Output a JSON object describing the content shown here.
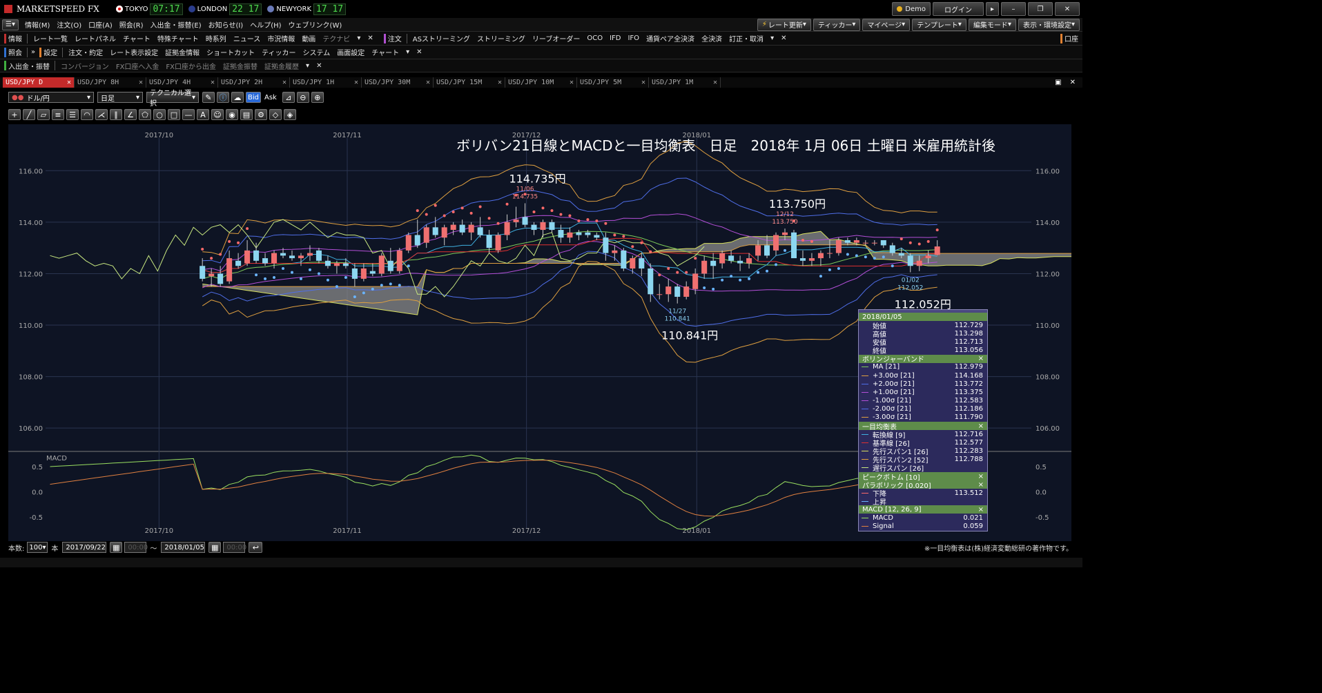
{
  "titlebar": {
    "logo": "MARKETSPEED FX",
    "clocks": [
      {
        "city": "TOKYO",
        "time": "07:17"
      },
      {
        "city": "LONDON",
        "time": "22 17"
      },
      {
        "city": "NEWYORK",
        "time": "17 17"
      }
    ],
    "demo": "Demo",
    "login": "ログイン"
  },
  "menubar": {
    "items": [
      "情報(M)",
      "注文(O)",
      "口座(A)",
      "照会(R)",
      "入出金・振替(E)",
      "お知らせ(I)",
      "ヘルプ(H)",
      "ウェブリンク(W)"
    ],
    "right_buttons": [
      "レート更新",
      "ティッカー",
      "マイページ",
      "テンプレート",
      "編集モード",
      "表示・環境設定"
    ]
  },
  "toolbar1": {
    "left_label": "情報",
    "items": [
      "レート一覧",
      "レートパネル",
      "チャート",
      "特殊チャート",
      "時系列",
      "ニュース",
      "市況情報",
      "動画",
      "テクナビ"
    ],
    "order_label": "注文",
    "order_items": [
      "ASストリーミング",
      "ストリーミング",
      "リーブオーダー",
      "OCO",
      "IFD",
      "IFO",
      "通貨ペア全決済",
      "全決済",
      "訂正・取消"
    ],
    "right_label": "口座"
  },
  "toolbar2": {
    "left_label": "照会",
    "settings_label": "設定",
    "items": [
      "注文・約定",
      "レート表示設定",
      "証拠金情報",
      "ショートカット",
      "ティッカー",
      "システム",
      "画面設定",
      "チャート"
    ]
  },
  "toolbar3": {
    "left_label": "入出金・振替",
    "items": [
      "コンバージョン",
      "FX口座へ入金",
      "FX口座から出金",
      "証拠金振替",
      "証拠金履歴"
    ]
  },
  "tabs": [
    "USD/JPY D",
    "USD/JPY 8H",
    "USD/JPY 4H",
    "USD/JPY 2H",
    "USD/JPY 1H",
    "USD/JPY 30M",
    "USD/JPY 15M",
    "USD/JPY 10M",
    "USD/JPY 5M",
    "USD/JPY 1M"
  ],
  "controls": {
    "pair": "ドル/円",
    "timeframe": "日足",
    "technical": "テクニカル選択",
    "bid": "Bid",
    "ask": "Ask"
  },
  "footer": {
    "count_label": "本数:",
    "count_value": "100",
    "count_unit": "本",
    "start_date": "2017/09/22",
    "time_placeholder": "00:00",
    "tilde": "〜",
    "end_date": "2018/01/05",
    "copyright": "※一目均衡表は(株)経済変動総研の著作物です。"
  },
  "chart_data": {
    "type": "candlestick",
    "title": "ボリバン21日線とMACDと一目均衡表　日足　2018年 1月 06日 土曜日 米雇用統計後",
    "y_ticks": [
      "116.00",
      "114.00",
      "112.00",
      "110.00",
      "108.00",
      "106.00"
    ],
    "x_ticks": [
      "2017/10",
      "2017/11",
      "2017/12",
      "2018/01"
    ],
    "ylim": [
      105.2,
      117.0
    ],
    "macd_label": "MACD",
    "macd_ticks": [
      "0.5",
      "0.0",
      "-0.5"
    ],
    "macd_ylim": [
      -0.72,
      0.72
    ],
    "annotations": [
      {
        "text": "114.735円",
        "date": "11/06",
        "value": "114.735"
      },
      {
        "text": "113.750円",
        "date": "12/12",
        "value": "113.750"
      },
      {
        "text": "110.841円",
        "date": "11/27",
        "value": "110.841"
      },
      {
        "text": "112.052円",
        "date": "01/02",
        "value": "112.052"
      }
    ],
    "candles": [
      [
        112.3,
        112.6,
        111.7,
        111.8
      ],
      [
        111.9,
        112.2,
        111.5,
        112.0
      ],
      [
        112.0,
        112.3,
        111.5,
        111.6
      ],
      [
        111.7,
        112.9,
        111.6,
        112.6
      ],
      [
        112.5,
        112.8,
        112.2,
        112.3
      ],
      [
        112.4,
        113.3,
        112.3,
        112.9
      ],
      [
        112.9,
        113.2,
        112.4,
        112.5
      ],
      [
        112.6,
        112.8,
        112.3,
        112.4
      ],
      [
        112.4,
        112.9,
        112.2,
        112.8
      ],
      [
        112.8,
        113.0,
        112.6,
        112.7
      ],
      [
        112.7,
        112.9,
        112.5,
        112.6
      ],
      [
        112.6,
        112.8,
        112.3,
        112.7
      ],
      [
        112.7,
        113.1,
        112.5,
        112.8
      ],
      [
        112.9,
        113.0,
        112.4,
        112.5
      ],
      [
        112.5,
        112.7,
        112.2,
        112.3
      ],
      [
        112.3,
        112.5,
        112.0,
        112.4
      ],
      [
        112.4,
        112.6,
        112.2,
        112.3
      ],
      [
        112.2,
        112.4,
        111.5,
        111.8
      ],
      [
        111.8,
        112.4,
        111.7,
        112.2
      ],
      [
        112.1,
        112.4,
        111.9,
        112.0
      ],
      [
        112.0,
        112.8,
        111.9,
        112.7
      ],
      [
        112.5,
        113.0,
        112.0,
        112.1
      ],
      [
        112.1,
        113.0,
        112.0,
        112.9
      ],
      [
        112.9,
        113.6,
        112.8,
        113.5
      ],
      [
        113.5,
        114.1,
        113.0,
        113.1
      ],
      [
        113.2,
        113.9,
        113.0,
        113.8
      ],
      [
        113.8,
        114.2,
        113.4,
        113.5
      ],
      [
        113.4,
        113.9,
        113.1,
        113.8
      ],
      [
        113.7,
        114.0,
        113.5,
        113.9
      ],
      [
        113.9,
        114.1,
        113.5,
        113.6
      ],
      [
        113.6,
        114.0,
        113.3,
        113.9
      ],
      [
        113.8,
        114.2,
        113.4,
        113.5
      ],
      [
        113.5,
        113.7,
        112.8,
        113.0
      ],
      [
        112.9,
        113.6,
        112.8,
        113.5
      ],
      [
        113.5,
        114.3,
        113.3,
        114.0
      ],
      [
        114.0,
        114.6,
        113.8,
        114.1
      ],
      [
        114.2,
        114.735,
        113.8,
        113.9
      ],
      [
        113.9,
        114.0,
        113.5,
        113.7
      ],
      [
        113.7,
        114.1,
        113.4,
        114.0
      ],
      [
        114.0,
        114.1,
        113.6,
        113.7
      ],
      [
        113.7,
        113.9,
        113.2,
        113.4
      ],
      [
        113.4,
        113.8,
        113.2,
        113.6
      ],
      [
        113.6,
        113.7,
        113.3,
        113.5
      ],
      [
        113.6,
        113.7,
        113.4,
        113.5
      ],
      [
        113.5,
        113.6,
        113.3,
        113.4
      ],
      [
        113.4,
        113.6,
        112.5,
        112.8
      ],
      [
        112.8,
        113.1,
        112.5,
        112.9
      ],
      [
        112.9,
        113.0,
        112.1,
        112.2
      ],
      [
        112.2,
        112.7,
        112.0,
        112.6
      ],
      [
        112.6,
        112.8,
        111.9,
        112.2
      ],
      [
        112.2,
        112.4,
        110.9,
        111.2
      ],
      [
        111.2,
        111.6,
        111.0,
        111.2
      ],
      [
        111.2,
        111.8,
        110.9,
        111.5
      ],
      [
        111.5,
        111.6,
        110.841,
        111.1
      ],
      [
        111.1,
        111.7,
        111.0,
        111.5
      ],
      [
        111.4,
        112.2,
        111.2,
        112.0
      ],
      [
        112.0,
        112.7,
        111.8,
        112.5
      ],
      [
        112.5,
        112.8,
        111.8,
        112.3
      ],
      [
        112.4,
        112.9,
        112.2,
        112.8
      ],
      [
        112.7,
        112.9,
        112.4,
        112.5
      ],
      [
        112.5,
        112.7,
        112.1,
        112.4
      ],
      [
        112.4,
        112.8,
        112.2,
        112.6
      ],
      [
        112.7,
        113.3,
        112.5,
        113.1
      ],
      [
        113.1,
        113.5,
        112.6,
        112.7
      ],
      [
        112.9,
        113.6,
        112.7,
        113.5
      ],
      [
        113.5,
        113.75,
        113.3,
        113.6
      ],
      [
        113.6,
        113.7,
        112.7,
        112.6
      ],
      [
        112.6,
        112.9,
        112.3,
        112.5
      ],
      [
        112.5,
        112.8,
        112.3,
        112.6
      ],
      [
        112.6,
        112.9,
        112.3,
        112.8
      ],
      [
        112.8,
        113.3,
        112.6,
        112.8
      ],
      [
        112.8,
        113.4,
        112.7,
        113.3
      ],
      [
        113.3,
        113.4,
        113.1,
        113.2
      ],
      [
        113.2,
        113.4,
        113.1,
        113.3
      ],
      [
        113.2,
        113.3,
        113.1,
        113.2
      ],
      [
        113.2,
        113.3,
        113.1,
        113.2
      ],
      [
        113.3,
        113.3,
        113.0,
        113.1
      ],
      [
        113.1,
        113.2,
        112.7,
        112.8
      ],
      [
        112.8,
        113.0,
        112.6,
        112.7
      ],
      [
        112.7,
        112.8,
        112.052,
        112.3
      ],
      [
        112.3,
        112.7,
        112.1,
        112.5
      ],
      [
        112.6,
        112.9,
        112.4,
        112.7
      ],
      [
        112.729,
        113.298,
        112.713,
        113.056
      ]
    ],
    "hist_len": 100,
    "series": [
      {
        "name": "MA [21]",
        "last": "112.979"
      },
      {
        "name": "+3.00σ [21]",
        "last": "114.168"
      },
      {
        "name": "+2.00σ [21]",
        "last": "113.772"
      },
      {
        "name": "+1.00σ [21]",
        "last": "113.375"
      },
      {
        "name": "-1.00σ [21]",
        "last": "112.583"
      },
      {
        "name": "-2.00σ [21]",
        "last": "112.186"
      },
      {
        "name": "-3.00σ [21]",
        "last": "111.790"
      }
    ]
  },
  "data_panel": {
    "date": "2018/01/05",
    "ohlc": [
      {
        "label": "始値",
        "value": "112.729"
      },
      {
        "label": "高値",
        "value": "113.298"
      },
      {
        "label": "安値",
        "value": "112.713"
      },
      {
        "label": "終値",
        "value": "113.056"
      }
    ],
    "sections": [
      {
        "title": "ボリンジャーバンド",
        "rows": [
          {
            "label": "MA [21]",
            "value": "112.979",
            "color": "#7ecb5a"
          },
          {
            "label": "+3.00σ [21]",
            "value": "114.168",
            "color": "#e0a040"
          },
          {
            "label": "+2.00σ [21]",
            "value": "113.772",
            "color": "#4f6ee8"
          },
          {
            "label": "+1.00σ [21]",
            "value": "113.375",
            "color": "#b44fd8"
          },
          {
            "label": "-1.00σ [21]",
            "value": "112.583",
            "color": "#b44fd8"
          },
          {
            "label": "-2.00σ [21]",
            "value": "112.186",
            "color": "#4f6ee8"
          },
          {
            "label": "-3.00σ [21]",
            "value": "111.790",
            "color": "#e0a040"
          }
        ]
      },
      {
        "title": "一目均衡表",
        "rows": [
          {
            "label": "転換線 [9]",
            "value": "112.716",
            "color": "#3fb0e0"
          },
          {
            "label": "基準線 [26]",
            "value": "112.577",
            "color": "#e03030"
          },
          {
            "label": "先行スパン1 [26]",
            "value": "112.283",
            "color": "#d8e060"
          },
          {
            "label": "先行スパン2 [52]",
            "value": "112.788",
            "color": "#e0a040"
          },
          {
            "label": "遅行スパン [26]",
            "value": "",
            "color": "#c8e880"
          }
        ]
      },
      {
        "title": "ピークボトム [10]",
        "rows": []
      },
      {
        "title": "パラボリック [0.020]",
        "rows": [
          {
            "label": "下降",
            "value": "113.512",
            "color": "#ff6a6a"
          },
          {
            "label": "上昇",
            "value": "",
            "color": "#6ab4ff"
          }
        ]
      },
      {
        "title": "MACD [12, 26, 9]",
        "rows": [
          {
            "label": "MACD",
            "value": "0.021",
            "color": "#9ae060"
          },
          {
            "label": "Signal",
            "value": "0.059",
            "color": "#e08040"
          }
        ]
      }
    ]
  },
  "colors": {
    "background": "#0e1424",
    "bull": "#f07070",
    "bear": "#8cd6f0",
    "cloud": "#8a8a8a"
  }
}
